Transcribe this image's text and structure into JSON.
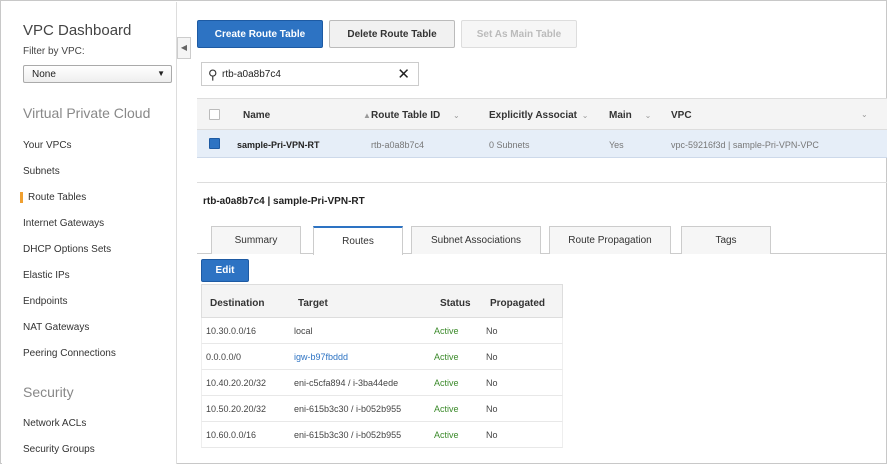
{
  "sidebar": {
    "title": "VPC Dashboard",
    "filter_label": "Filter by VPC:",
    "filter_value": "None",
    "section_vpc": "Virtual Private Cloud",
    "vpc_items": [
      "Your VPCs",
      "Subnets",
      "Route Tables",
      "Internet Gateways",
      "DHCP Options Sets",
      "Elastic IPs",
      "Endpoints",
      "NAT Gateways",
      "Peering Connections"
    ],
    "active_item": "Route Tables",
    "section_security": "Security",
    "security_items": [
      "Network ACLs",
      "Security Groups"
    ]
  },
  "toolbar": {
    "create_label": "Create Route Table",
    "delete_label": "Delete Route Table",
    "set_main_label": "Set As Main Table"
  },
  "search": {
    "value": "rtb-a0a8b7c4"
  },
  "route_tables": {
    "columns": [
      "Name",
      "Route Table ID",
      "Explicitly Associat",
      "Main",
      "VPC"
    ],
    "rows": [
      {
        "name": "sample-Pri-VPN-RT",
        "route_table_id": "rtb-a0a8b7c4",
        "explicitly_associated": "0 Subnets",
        "main": "Yes",
        "vpc": "vpc-59216f3d | sample-Pri-VPN-VPC"
      }
    ]
  },
  "detail": {
    "title": "rtb-a0a8b7c4 | sample-Pri-VPN-RT",
    "tabs": [
      "Summary",
      "Routes",
      "Subnet Associations",
      "Route Propagation",
      "Tags"
    ],
    "active_tab": "Routes",
    "edit_label": "Edit"
  },
  "routes": {
    "columns": [
      "Destination",
      "Target",
      "Status",
      "Propagated"
    ],
    "rows": [
      {
        "destination": "10.30.0.0/16",
        "target": "local",
        "status": "Active",
        "propagated": "No"
      },
      {
        "destination": "0.0.0.0/0",
        "target": "igw-b97fbddd",
        "status": "Active",
        "propagated": "No"
      },
      {
        "destination": "10.40.20.20/32",
        "target": "eni-c5cfa894 / i-3ba44ede",
        "status": "Active",
        "propagated": "No"
      },
      {
        "destination": "10.50.20.20/32",
        "target": "eni-615b3c30 / i-b052b955",
        "status": "Active",
        "propagated": "No"
      },
      {
        "destination": "10.60.0.0/16",
        "target": "eni-615b3c30 / i-b052b955",
        "status": "Active",
        "propagated": "No"
      }
    ]
  },
  "colors": {
    "primary_button": "#2d73c3",
    "active_status": "#3b8a2a",
    "sidebar_active_marker": "#f0a030",
    "selected_row": "#e6eef8"
  },
  "icons": {
    "search": "search-icon",
    "clear": "close-icon",
    "collapse": "chevron-left-icon",
    "dropdown": "chevron-down-icon",
    "sort": "sort-icon"
  }
}
